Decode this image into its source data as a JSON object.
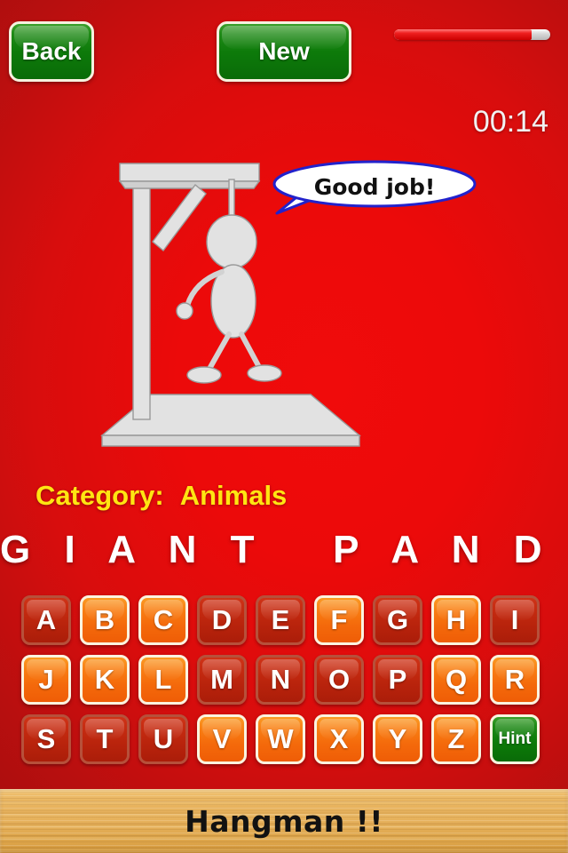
{
  "toolbar": {
    "back_label": "Back",
    "new_label": "New",
    "progress_percent": 88
  },
  "timer": {
    "value": "00:14"
  },
  "message": {
    "bubble_text": "Good job!"
  },
  "puzzle": {
    "category_label": "Category:",
    "category_value": "Animals",
    "word_display": "G I A N T   P A N D A"
  },
  "keyboard": {
    "hint_label": "Hint",
    "rows": [
      [
        {
          "letter": "A",
          "state": "used"
        },
        {
          "letter": "B",
          "state": "available"
        },
        {
          "letter": "C",
          "state": "available"
        },
        {
          "letter": "D",
          "state": "used"
        },
        {
          "letter": "E",
          "state": "used"
        },
        {
          "letter": "F",
          "state": "available"
        },
        {
          "letter": "G",
          "state": "used"
        },
        {
          "letter": "H",
          "state": "available"
        },
        {
          "letter": "I",
          "state": "used"
        }
      ],
      [
        {
          "letter": "J",
          "state": "available"
        },
        {
          "letter": "K",
          "state": "available"
        },
        {
          "letter": "L",
          "state": "available"
        },
        {
          "letter": "M",
          "state": "used"
        },
        {
          "letter": "N",
          "state": "used"
        },
        {
          "letter": "O",
          "state": "used"
        },
        {
          "letter": "P",
          "state": "used"
        },
        {
          "letter": "Q",
          "state": "available"
        },
        {
          "letter": "R",
          "state": "available"
        }
      ],
      [
        {
          "letter": "S",
          "state": "used"
        },
        {
          "letter": "T",
          "state": "used"
        },
        {
          "letter": "U",
          "state": "used"
        },
        {
          "letter": "V",
          "state": "available"
        },
        {
          "letter": "W",
          "state": "available"
        },
        {
          "letter": "X",
          "state": "available"
        },
        {
          "letter": "Y",
          "state": "available"
        },
        {
          "letter": "Z",
          "state": "available"
        }
      ]
    ]
  },
  "footer": {
    "app_title": "Hangman !!"
  },
  "colors": {
    "background_center": "#ee0a0a",
    "background_edge": "#a00d0d",
    "button_green": "#0d7a0a",
    "key_available": "#f4690b",
    "key_used": "#b8230c",
    "category_yellow": "#ffe512",
    "bubble_outline": "#2222cc",
    "gallows_fill": "#e2e2e2",
    "wood_bar": "#e6b15c"
  }
}
